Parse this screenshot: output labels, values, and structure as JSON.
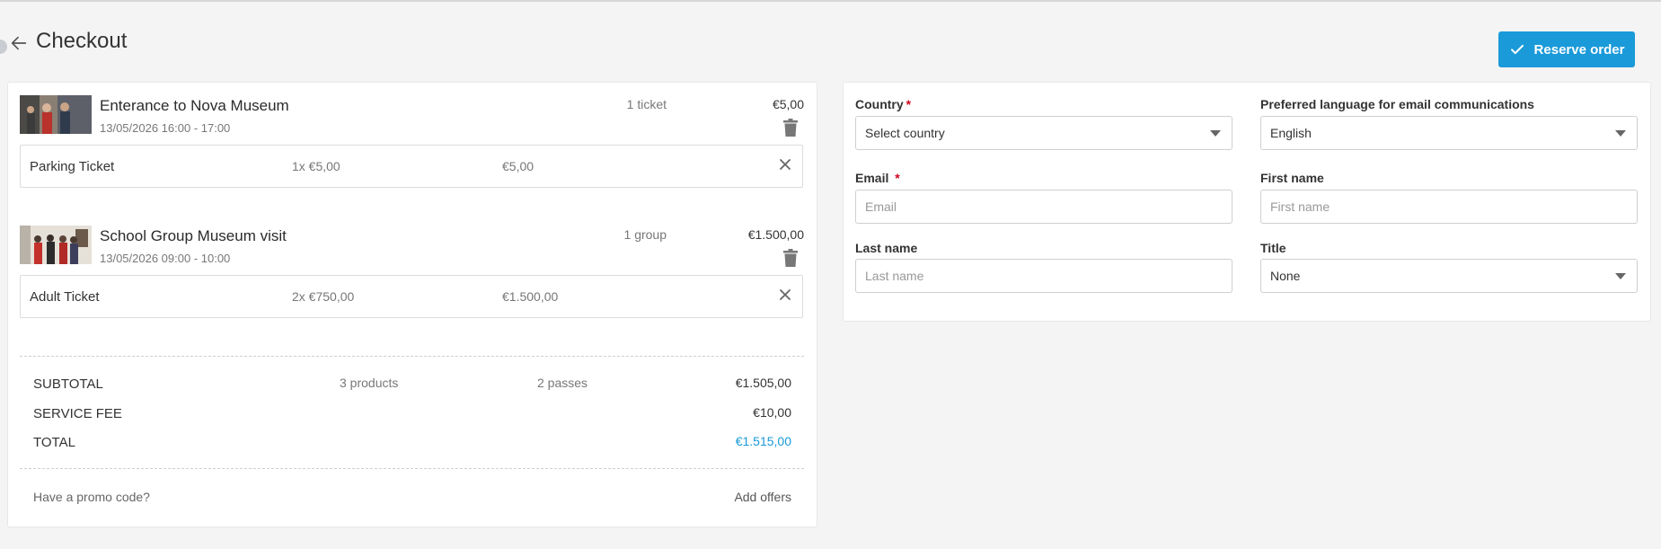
{
  "header": {
    "title": "Checkout"
  },
  "actions": {
    "reserve_label": "Reserve order"
  },
  "cart": {
    "events": [
      {
        "title": "Enterance to Nova Museum",
        "time": "13/05/2026 16:00 - 17:00",
        "qty": "1 ticket",
        "price": "€5,00",
        "item": {
          "name": "Parking Ticket",
          "qty": "1x €5,00",
          "total": "€5,00"
        }
      },
      {
        "title": "School Group Museum visit",
        "time": "13/05/2026 09:00 - 10:00",
        "qty": "1 group",
        "price": "€1.500,00",
        "item": {
          "name": "Adult Ticket",
          "qty": "2x €750,00",
          "total": "€1.500,00"
        }
      }
    ],
    "summary": {
      "subtotal_label": "SUBTOTAL",
      "products": "3 products",
      "passes": "2 passes",
      "subtotal": "€1.505,00",
      "fee_label": "SERVICE FEE",
      "fee": "€10,00",
      "total_label": "TOTAL",
      "total": "€1.515,00"
    },
    "promo_label": "Have a promo code?",
    "add_offers_label": "Add offers"
  },
  "form": {
    "country_label": "Country",
    "country_value": "Select country",
    "language_label": "Preferred language for email communications",
    "language_value": "English",
    "email_label": "Email",
    "email_placeholder": "Email",
    "first_name_label": "First name",
    "first_name_placeholder": "First name",
    "last_name_label": "Last name",
    "last_name_placeholder": "Last name",
    "title_label": "Title",
    "title_value": "None",
    "required_mark": "*"
  },
  "colors": {
    "accent": "#1a9ad9",
    "required": "#d0021b"
  }
}
